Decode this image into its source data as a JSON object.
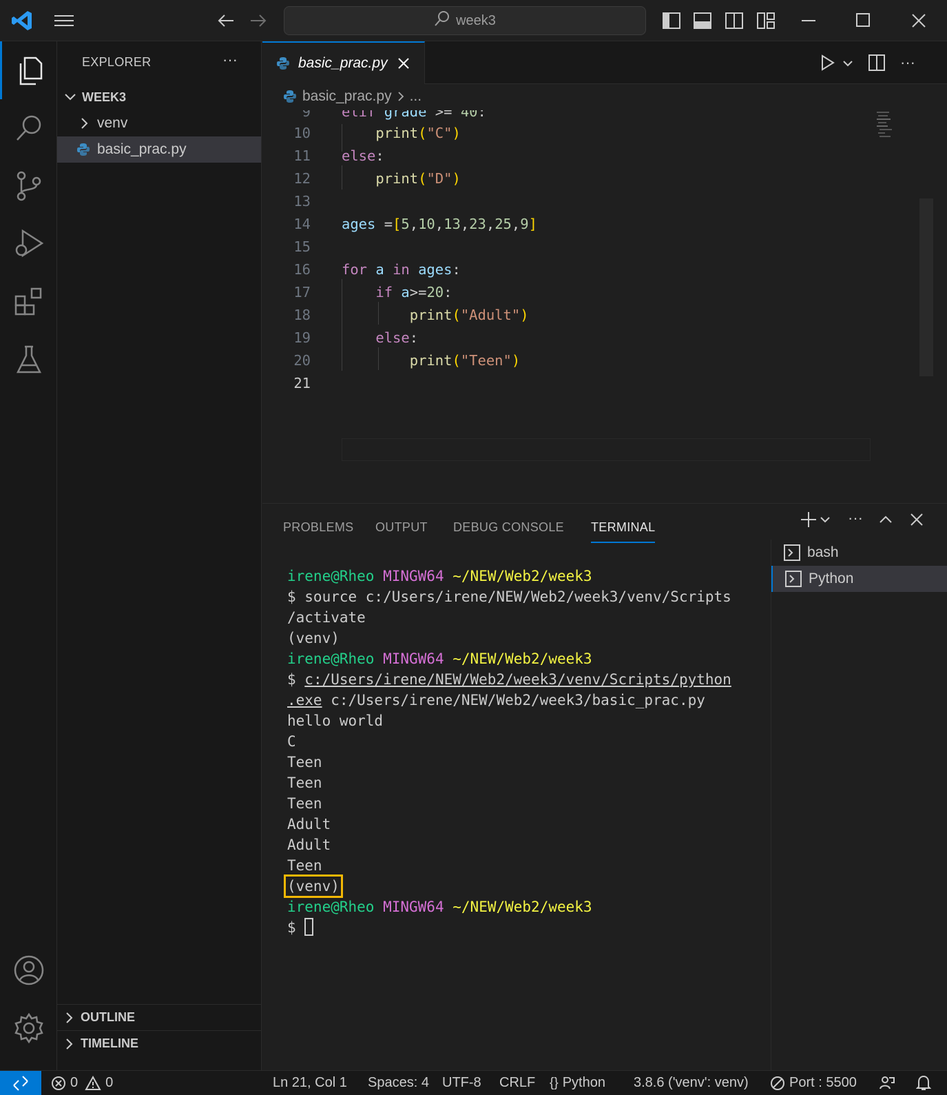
{
  "titlebar": {
    "search_text": "week3"
  },
  "sidebar": {
    "title": "EXPLORER",
    "more": "···",
    "folder": "WEEK3",
    "items": [
      {
        "label": "venv",
        "type": "folder"
      },
      {
        "label": "basic_prac.py",
        "type": "python-file"
      }
    ],
    "outline": "OUTLINE",
    "timeline": "TIMELINE"
  },
  "editor": {
    "tab_label": "basic_prac.py",
    "breadcrumb_file": "basic_prac.py",
    "breadcrumb_rest": "...",
    "line_numbers": [
      "9",
      "10",
      "11",
      "12",
      "13",
      "14",
      "15",
      "16",
      "17",
      "18",
      "19",
      "20",
      "21"
    ],
    "partial_line": "elif grade >= 40:"
  },
  "panel": {
    "tabs": [
      "PROBLEMS",
      "OUTPUT",
      "DEBUG CONSOLE",
      "TERMINAL"
    ],
    "active_tab": "TERMINAL",
    "terminal": {
      "user": "irene@Rheo",
      "host": "MINGW64",
      "path": "~/NEW/Web2/week3",
      "cmd1_line1": "$ source c:/Users/irene/NEW/Web2/week3/venv/Scripts",
      "cmd1_line2": "/activate",
      "venv": "(venv)",
      "cmd2_prefix": "$ ",
      "cmd2_link1": "c:/Users/irene/NEW/Web2/week3/venv/Scripts/python",
      "cmd2_link2": ".exe",
      "cmd2_rest": " c:/Users/irene/NEW/Web2/week3/basic_prac.py",
      "output": [
        "hello world",
        "C",
        "Teen",
        "Teen",
        "Teen",
        "Adult",
        "Adult",
        "Teen"
      ],
      "prompt": "$ "
    },
    "terminal_list": [
      "bash",
      "Python"
    ]
  },
  "statusbar": {
    "errors": "0",
    "warnings": "0",
    "position": "Ln 21, Col 1",
    "spaces": "Spaces: 4",
    "encoding": "UTF-8",
    "eol": "CRLF",
    "language": "Python",
    "interpreter": "3.8.6 ('venv': venv)",
    "port": "Port : 5500"
  },
  "colors": {
    "accent": "#0078d4",
    "highlight_box": "#f2b705"
  }
}
